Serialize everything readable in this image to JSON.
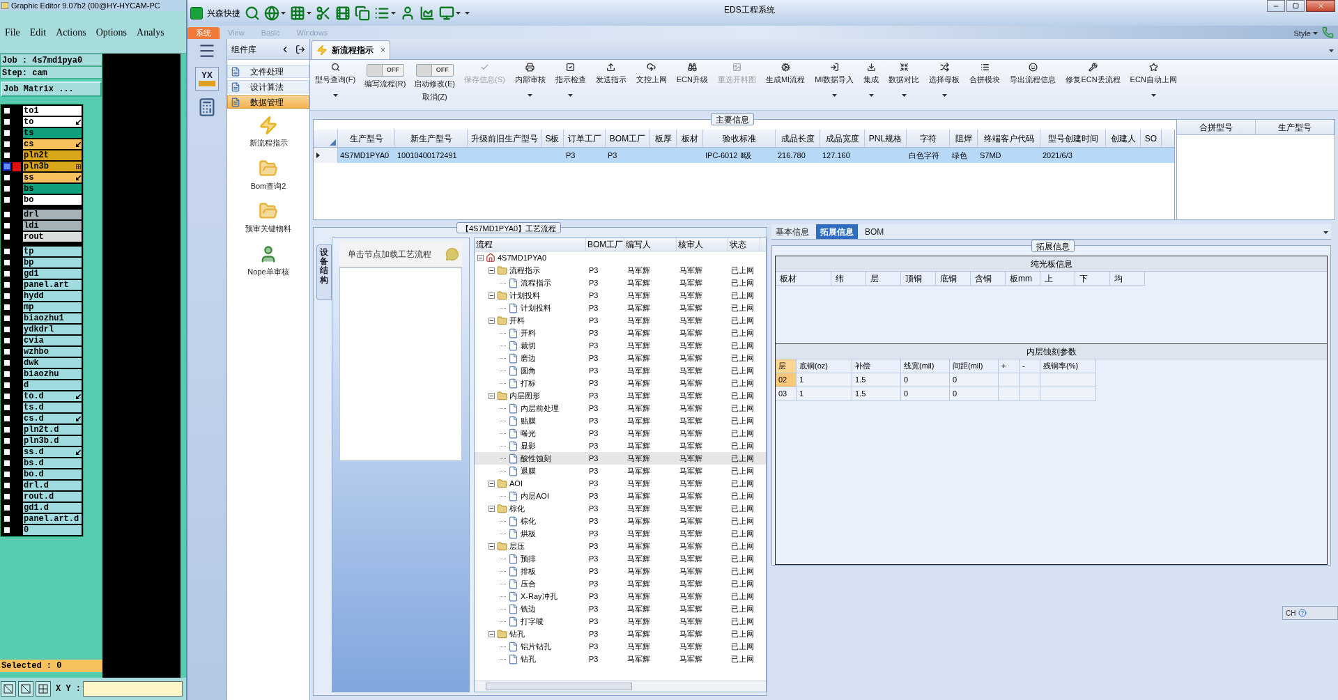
{
  "editor": {
    "title": "Graphic Editor 9.07b2 (00@HY-HYCAM-PC",
    "menu": [
      "File",
      "Edit",
      "Actions",
      "Options",
      "Analys"
    ],
    "job": "Job : 4s7md1pya0",
    "step": "Step: cam",
    "matrix_button": "Job Matrix ...",
    "layer_groups": [
      [
        {
          "name": "to1",
          "color": "#ffffff",
          "kind": "plain",
          "selected": false
        },
        {
          "name": "to",
          "color": "#ffffff",
          "kind": "arrow",
          "selected": false
        },
        {
          "name": "ts",
          "color": "#10a07e",
          "kind": "plain",
          "selected": false
        },
        {
          "name": "cs",
          "color": "#f7c25e",
          "kind": "arrow",
          "selected": false
        },
        {
          "name": "pln2t",
          "color": "#d9a61a",
          "kind": "plain",
          "selected": false
        },
        {
          "name": "pln3b",
          "color": "#d9a61a",
          "kind": "grid",
          "selected": true
        },
        {
          "name": "ss",
          "color": "#f7c25e",
          "kind": "arrow",
          "selected": false
        },
        {
          "name": "bs",
          "color": "#10a07e",
          "kind": "plain",
          "selected": false
        },
        {
          "name": "bo",
          "color": "#ffffff",
          "kind": "plain",
          "selected": false
        }
      ],
      [
        {
          "name": "drl",
          "color": "#a5b3b8",
          "kind": "plain",
          "selected": false
        },
        {
          "name": "ldi",
          "color": "#a5b3b8",
          "kind": "plain",
          "selected": false
        },
        {
          "name": "rout",
          "color": "#d9dcdc",
          "kind": "plain",
          "selected": false
        }
      ],
      [
        {
          "name": "tp",
          "color": "#a0dcdf",
          "kind": "plain",
          "selected": false
        },
        {
          "name": "bp",
          "color": "#a0dcdf",
          "kind": "plain",
          "selected": false
        },
        {
          "name": "gd1",
          "color": "#a0dcdf",
          "kind": "plain",
          "selected": false
        },
        {
          "name": "panel.art",
          "color": "#a0dcdf",
          "kind": "plain",
          "selected": false
        },
        {
          "name": "hydd",
          "color": "#a0dcdf",
          "kind": "plain",
          "selected": false
        },
        {
          "name": "mp",
          "color": "#a0dcdf",
          "kind": "plain",
          "selected": false
        },
        {
          "name": "biaozhu1",
          "color": "#a0dcdf",
          "kind": "plain",
          "selected": false
        },
        {
          "name": "ydkdrl",
          "color": "#a0dcdf",
          "kind": "plain",
          "selected": false
        },
        {
          "name": "cvia",
          "color": "#a0dcdf",
          "kind": "plain",
          "selected": false
        },
        {
          "name": "wzhbo",
          "color": "#a0dcdf",
          "kind": "plain",
          "selected": false
        },
        {
          "name": "dwk",
          "color": "#a0dcdf",
          "kind": "plain",
          "selected": false
        },
        {
          "name": "biaozhu",
          "color": "#a0dcdf",
          "kind": "plain",
          "selected": false
        },
        {
          "name": "d",
          "color": "#a0dcdf",
          "kind": "plain",
          "selected": false
        },
        {
          "name": "to.d",
          "color": "#a0dcdf",
          "kind": "arrow",
          "selected": false
        },
        {
          "name": "ts.d",
          "color": "#a0dcdf",
          "kind": "plain",
          "selected": false
        },
        {
          "name": "cs.d",
          "color": "#a0dcdf",
          "kind": "arrow",
          "selected": false
        },
        {
          "name": "pln2t.d",
          "color": "#a0dcdf",
          "kind": "plain",
          "selected": false
        },
        {
          "name": "pln3b.d",
          "color": "#a0dcdf",
          "kind": "plain",
          "selected": false
        },
        {
          "name": "ss.d",
          "color": "#a0dcdf",
          "kind": "arrow",
          "selected": false
        },
        {
          "name": "bs.d",
          "color": "#a0dcdf",
          "kind": "plain",
          "selected": false
        },
        {
          "name": "bo.d",
          "color": "#a0dcdf",
          "kind": "plain",
          "selected": false
        },
        {
          "name": "drl.d",
          "color": "#a0dcdf",
          "kind": "plain",
          "selected": false
        },
        {
          "name": "rout.d",
          "color": "#a0dcdf",
          "kind": "plain",
          "selected": false
        },
        {
          "name": "gd1.d",
          "color": "#a0dcdf",
          "kind": "plain",
          "selected": false
        },
        {
          "name": "panel.art.d",
          "color": "#a0dcdf",
          "kind": "plain",
          "selected": false
        },
        {
          "name": "0",
          "color": "#a0dcdf",
          "kind": "plain",
          "selected": false
        }
      ]
    ],
    "selected_count": "Selected : 0",
    "xy_label": "X Y :"
  },
  "app": {
    "name": "兴森快捷",
    "title": "EDS工程系统"
  },
  "ribbon": {
    "tabs": [
      {
        "label": "系统",
        "selected": true
      },
      {
        "label": "View",
        "selected": false
      },
      {
        "label": "Basic",
        "selected": false
      },
      {
        "label": "Windows",
        "selected": false
      }
    ],
    "style_menu": "Style"
  },
  "sidebar": {
    "logo": "YX"
  },
  "components": {
    "title": "组件库",
    "items": [
      {
        "label": "文件处理",
        "selected": false
      },
      {
        "label": "设计算法",
        "selected": false
      },
      {
        "label": "数据管理",
        "selected": true
      }
    ],
    "tools": [
      "新流程指示",
      "Bom查询2",
      "预审关键物料",
      "Nope单审核"
    ]
  },
  "document_tab": {
    "label": "新流程指示",
    "close": "×"
  },
  "toolbar": [
    {
      "kind": "button",
      "label": "型号查询(F)",
      "disabled": false,
      "dropdown": true
    },
    {
      "kind": "toggle",
      "label": "编写流程(R)",
      "state_text": "OFF",
      "on": false
    },
    {
      "kind": "toggle",
      "label": "启动修改(E)",
      "sublabel": "取消(Z)",
      "state_text": "OFF",
      "on": false
    },
    {
      "kind": "button",
      "label": "保存信息(S)",
      "disabled": true,
      "dropdown": false
    },
    {
      "kind": "button",
      "label": "内部审核",
      "disabled": false,
      "dropdown": true
    },
    {
      "kind": "button",
      "label": "指示检查",
      "disabled": false,
      "dropdown": true
    },
    {
      "kind": "button",
      "label": "发送指示",
      "disabled": false,
      "dropdown": false
    },
    {
      "kind": "button",
      "label": "文控上网",
      "disabled": false,
      "dropdown": false
    },
    {
      "kind": "button",
      "label": "ECN升级",
      "disabled": false,
      "dropdown": false
    },
    {
      "kind": "button",
      "label": "重选开料图",
      "disabled": true,
      "dropdown": false
    },
    {
      "kind": "button",
      "label": "生成MI流程",
      "disabled": false,
      "dropdown": false
    },
    {
      "kind": "button",
      "label": "MI数据导入",
      "disabled": false,
      "dropdown": true
    },
    {
      "kind": "button",
      "label": "集成",
      "disabled": false,
      "dropdown": true
    },
    {
      "kind": "button",
      "label": "数据对比",
      "disabled": false,
      "dropdown": true
    },
    {
      "kind": "button",
      "label": "选择母板",
      "disabled": false,
      "dropdown": true
    },
    {
      "kind": "button",
      "label": "合拼模块",
      "disabled": false,
      "dropdown": false
    },
    {
      "kind": "button",
      "label": "导出流程信息",
      "disabled": false,
      "dropdown": false
    },
    {
      "kind": "button",
      "label": "修复ECN丢流程",
      "disabled": false,
      "dropdown": false
    },
    {
      "kind": "button",
      "label": "ECN自动上网",
      "disabled": false,
      "dropdown": true
    }
  ],
  "main_info": {
    "title": "主要信息",
    "columns": [
      "生产型号",
      "新生产型号",
      "升级前旧生产型号",
      "S板",
      "订单工厂",
      "BOM工厂",
      "板厚",
      "板材",
      "验收标准",
      "成品长度",
      "成品宽度",
      "PNL规格",
      "字符",
      "阻焊",
      "终端客户代码",
      "型号创建时间",
      "创建人",
      "SO"
    ],
    "rows": [
      {
        "selected": true,
        "cells": [
          "4S7MD1PYA0",
          "10010400172491",
          null,
          null,
          "P3",
          "P3",
          null,
          null,
          "IPC-6012 Ⅱ级",
          "216.780",
          "127.160",
          null,
          "白色字符",
          "绿色",
          "S7MD",
          "2021/6/3",
          null,
          null
        ]
      }
    ],
    "side_columns": [
      "合拼型号",
      "生产型号"
    ]
  },
  "flow": {
    "title": "【4S7MD1PYA0】工艺流程",
    "side_tab": "设备结构",
    "hint": "单击节点加载工艺流程",
    "columns": [
      "流程",
      "BOM工厂",
      "编写人",
      "核审人",
      "状态"
    ],
    "tree": {
      "kind": "root",
      "label": "4S7MD1PYA0",
      "expanded": true,
      "selected": false,
      "children": [
        {
          "kind": "folder",
          "label": "流程指示",
          "bom": "P3",
          "author": "马军辉",
          "reviewer": "马军辉",
          "status": "已上网",
          "expanded": true,
          "selected": false,
          "children": [
            {
              "kind": "file",
              "label": "流程指示",
              "bom": "P3",
              "author": "马军辉",
              "reviewer": "马军辉",
              "status": "已上网",
              "selected": false
            }
          ]
        },
        {
          "kind": "folder",
          "label": "计划投料",
          "bom": "P3",
          "author": "马军辉",
          "reviewer": "马军辉",
          "status": "已上网",
          "expanded": true,
          "selected": false,
          "children": [
            {
              "kind": "file",
              "label": "计划投料",
              "bom": "P3",
              "author": "马军辉",
              "reviewer": "马军辉",
              "status": "已上网",
              "selected": false
            }
          ]
        },
        {
          "kind": "folder",
          "label": "开料",
          "bom": "P3",
          "author": "马军辉",
          "reviewer": "马军辉",
          "status": "已上网",
          "expanded": true,
          "selected": false,
          "children": [
            {
              "kind": "file",
              "label": "开料",
              "bom": "P3",
              "author": "马军辉",
              "reviewer": "马军辉",
              "status": "已上网",
              "selected": false
            },
            {
              "kind": "file",
              "label": "裁切",
              "bom": "P3",
              "author": "马军辉",
              "reviewer": "马军辉",
              "status": "已上网",
              "selected": false
            },
            {
              "kind": "file",
              "label": "磨边",
              "bom": "P3",
              "author": "马军辉",
              "reviewer": "马军辉",
              "status": "已上网",
              "selected": false
            },
            {
              "kind": "file",
              "label": "圆角",
              "bom": "P3",
              "author": "马军辉",
              "reviewer": "马军辉",
              "status": "已上网",
              "selected": false
            },
            {
              "kind": "file",
              "label": "打标",
              "bom": "P3",
              "author": "马军辉",
              "reviewer": "马军辉",
              "status": "已上网",
              "selected": false
            }
          ]
        },
        {
          "kind": "folder",
          "label": "内层图形",
          "bom": "P3",
          "author": "马军辉",
          "reviewer": "马军辉",
          "status": "已上网",
          "expanded": true,
          "selected": false,
          "children": [
            {
              "kind": "file",
              "label": "内层前处理",
              "bom": "P3",
              "author": "马军辉",
              "reviewer": "马军辉",
              "status": "已上网",
              "selected": false
            },
            {
              "kind": "file",
              "label": "贴膜",
              "bom": "P3",
              "author": "马军辉",
              "reviewer": "马军辉",
              "status": "已上网",
              "selected": false
            },
            {
              "kind": "file",
              "label": "曝光",
              "bom": "P3",
              "author": "马军辉",
              "reviewer": "马军辉",
              "status": "已上网",
              "selected": false
            },
            {
              "kind": "file",
              "label": "显影",
              "bom": "P3",
              "author": "马军辉",
              "reviewer": "马军辉",
              "status": "已上网",
              "selected": false
            },
            {
              "kind": "file",
              "label": "酸性蚀刻",
              "bom": "P3",
              "author": "马军辉",
              "reviewer": "马军辉",
              "status": "已上网",
              "selected": true
            },
            {
              "kind": "file",
              "label": "退膜",
              "bom": "P3",
              "author": "马军辉",
              "reviewer": "马军辉",
              "status": "已上网",
              "selected": false
            }
          ]
        },
        {
          "kind": "folder",
          "label": "AOI",
          "bom": "P3",
          "author": "马军辉",
          "reviewer": "马军辉",
          "status": "已上网",
          "expanded": true,
          "selected": false,
          "children": [
            {
              "kind": "file",
              "label": "内层AOI",
              "bom": "P3",
              "author": "马军辉",
              "reviewer": "马军辉",
              "status": "已上网",
              "selected": false
            }
          ]
        },
        {
          "kind": "folder",
          "label": "棕化",
          "bom": "P3",
          "author": "马军辉",
          "reviewer": "马军辉",
          "status": "已上网",
          "expanded": true,
          "selected": false,
          "children": [
            {
              "kind": "file",
              "label": "棕化",
              "bom": "P3",
              "author": "马军辉",
              "reviewer": "马军辉",
              "status": "已上网",
              "selected": false
            },
            {
              "kind": "file",
              "label": "烘板",
              "bom": "P3",
              "author": "马军辉",
              "reviewer": "马军辉",
              "status": "已上网",
              "selected": false
            }
          ]
        },
        {
          "kind": "folder",
          "label": "层压",
          "bom": "P3",
          "author": "马军辉",
          "reviewer": "马军辉",
          "status": "已上网",
          "expanded": true,
          "selected": false,
          "children": [
            {
              "kind": "file",
              "label": "预排",
              "bom": "P3",
              "author": "马军辉",
              "reviewer": "马军辉",
              "status": "已上网",
              "selected": false
            },
            {
              "kind": "file",
              "label": "排板",
              "bom": "P3",
              "author": "马军辉",
              "reviewer": "马军辉",
              "status": "已上网",
              "selected": false
            },
            {
              "kind": "file",
              "label": "压合",
              "bom": "P3",
              "author": "马军辉",
              "reviewer": "马军辉",
              "status": "已上网",
              "selected": false
            },
            {
              "kind": "file",
              "label": "X-Ray冲孔",
              "bom": "P3",
              "author": "马军辉",
              "reviewer": "马军辉",
              "status": "已上网",
              "selected": false
            },
            {
              "kind": "file",
              "label": "铣边",
              "bom": "P3",
              "author": "马军辉",
              "reviewer": "马军辉",
              "status": "已上网",
              "selected": false
            },
            {
              "kind": "file",
              "label": "打字唛",
              "bom": "P3",
              "author": "马军辉",
              "reviewer": "马军辉",
              "status": "已上网",
              "selected": false
            }
          ]
        },
        {
          "kind": "folder",
          "label": "钻孔",
          "bom": "P3",
          "author": "马军辉",
          "reviewer": "马军辉",
          "status": "已上网",
          "expanded": true,
          "selected": false,
          "children": [
            {
              "kind": "file",
              "label": "铝片钻孔",
              "bom": "P3",
              "author": "马军辉",
              "reviewer": "马军辉",
              "status": "已上网",
              "selected": false
            },
            {
              "kind": "file",
              "label": "钻孔",
              "bom": "P3",
              "author": "马军辉",
              "reviewer": "马军辉",
              "status": "已上网",
              "selected": false
            }
          ]
        }
      ]
    }
  },
  "details": {
    "tabs": [
      {
        "label": "基本信息",
        "selected": false
      },
      {
        "label": "拓展信息",
        "selected": true
      },
      {
        "label": "BOM",
        "selected": false
      }
    ],
    "group_title": "拓展信息",
    "plain_board": {
      "title": "纯光板信息",
      "columns": [
        "板材",
        "纬",
        "层",
        "顶铜",
        "底铜",
        "含铜",
        "板mm",
        "上",
        "下",
        "均"
      ]
    },
    "etching": {
      "title": "内层蚀刻参数",
      "columns": [
        "层",
        "底铜(oz)",
        "补偿",
        "线宽(mil)",
        "间距(mil)",
        "+",
        "-",
        "残铜率(%)"
      ],
      "rows": [
        {
          "selected": true,
          "cells": [
            "02",
            "1",
            "1.5",
            "0",
            "0",
            null,
            null,
            null
          ]
        },
        {
          "selected": false,
          "cells": [
            "03",
            "1",
            "1.5",
            "0",
            "0",
            null,
            null,
            null
          ]
        }
      ]
    }
  },
  "language_bar": {
    "label": "CH"
  }
}
